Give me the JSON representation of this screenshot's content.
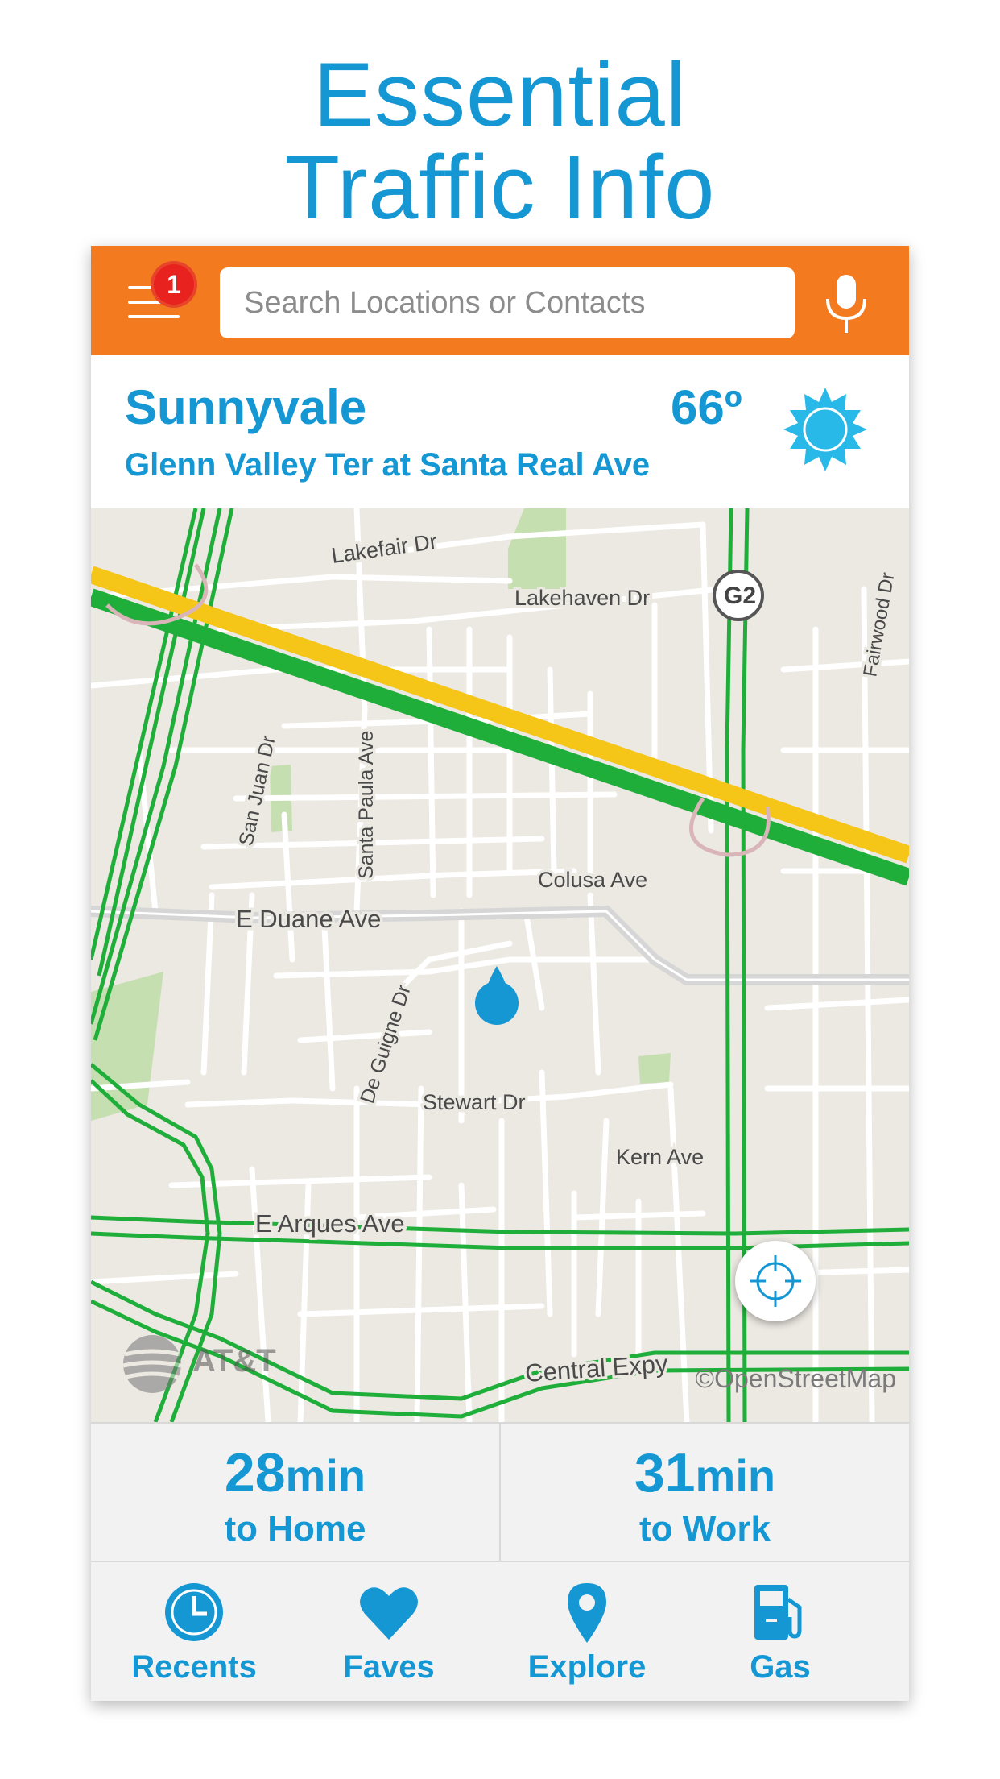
{
  "promo": {
    "line1": "Essential",
    "line2": "Traffic Info"
  },
  "header": {
    "menu_badge": "1",
    "search_placeholder": "Search Locations or Contacts",
    "mic_icon": "microphone-icon",
    "color": "#f47a1f"
  },
  "weather": {
    "city": "Sunnyvale",
    "address": "Glenn Valley Ter at Santa Real Ave",
    "temperature": "66º",
    "condition_icon": "sun-icon"
  },
  "map": {
    "street_labels": {
      "lakefair": "Lakefair Dr",
      "lakehaven": "Lakehaven Dr",
      "highway_shield": "G2",
      "fairwood": "Fairwood Dr",
      "san_juan": "San Juan Dr",
      "santa_paula": "Santa Paula Ave",
      "colusa": "Colusa Ave",
      "duane": "E Duane Ave",
      "de_guigne": "De Guigne Dr",
      "stewart": "Stewart Dr",
      "kern": "Kern Ave",
      "arques": "E Arques Ave",
      "central": "Central Expy"
    },
    "carrier_logo": "AT&T",
    "attribution": "©OpenStreetMap",
    "traffic_colors": {
      "free_flow": "#1fae3a",
      "slow": "#f5c518"
    }
  },
  "eta": {
    "home": {
      "value": "28",
      "unit": "min",
      "label": "to Home"
    },
    "work": {
      "value": "31",
      "unit": "min",
      "label": "to Work"
    }
  },
  "nav": {
    "items": [
      {
        "label": "Recents",
        "icon": "clock-icon"
      },
      {
        "label": "Faves",
        "icon": "heart-icon"
      },
      {
        "label": "Explore",
        "icon": "map-pin-icon"
      },
      {
        "label": "Gas",
        "icon": "gas-pump-icon"
      }
    ]
  },
  "accent_color": "#1597d4"
}
